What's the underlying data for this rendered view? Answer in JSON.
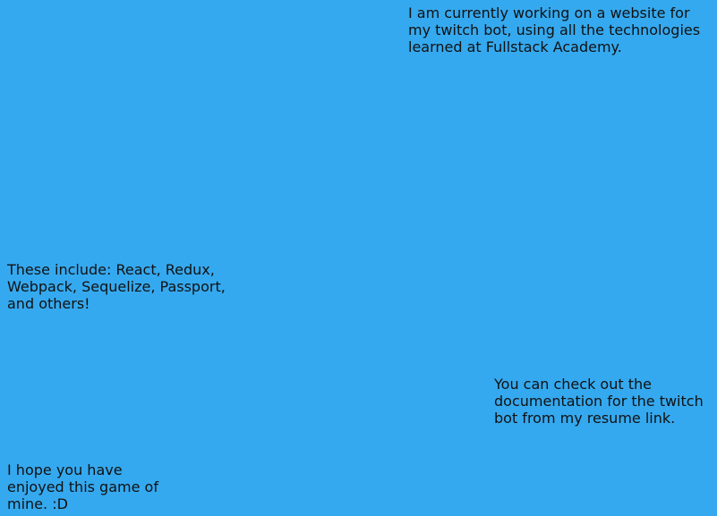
{
  "theme": {
    "background": "#35a9ef",
    "text_color": "#111111"
  },
  "messages": [
    {
      "text": "I am currently working on a website for my twitch bot, using all the technologies learned at Fullstack Academy."
    },
    {
      "text": "These include: React, Redux, Webpack, Sequelize, Passport, and others!"
    },
    {
      "text": "You can check out the documentation for the twitch bot from my resume link."
    },
    {
      "text": "I hope you have enjoyed this game of mine. :D"
    }
  ]
}
